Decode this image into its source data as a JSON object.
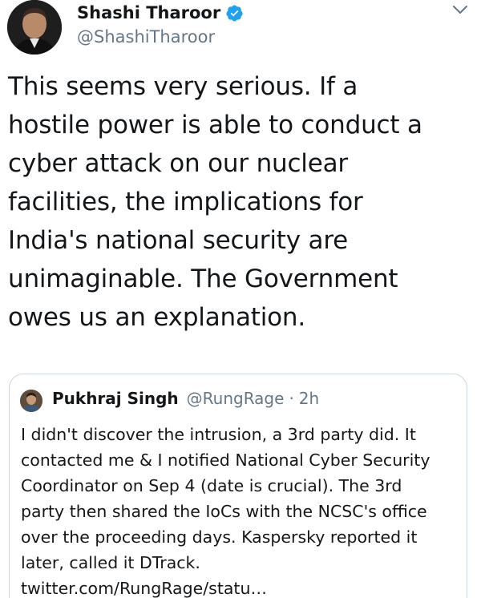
{
  "tweet": {
    "author_name": "Shashi Tharoor",
    "author_handle": "@ShashiTharoor",
    "text": "This seems very serious. If a\nhostile power is able to conduct a\ncyber attack on our nuclear\nfacilities, the implications for\nIndia's national security are\nunimaginable. The Government\nowes us an explanation."
  },
  "quoted_tweet": {
    "author_name": "Pukhraj Singh",
    "author_handle": "@RungRage",
    "separator": "·",
    "time": "2h",
    "text": "I didn't discover the intrusion, a 3rd party did. It\ncontacted me & I notified National Cyber Security\nCoordinator on Sep 4 (date is crucial). The 3rd\nparty then shared the IoCs with the NCSC's office\nover the proceeding days. Kaspersky reported it\nlater, called it DTrack.",
    "link": "twitter.com/RungRage/statu…"
  },
  "icons": {
    "verified": "verified-badge-icon",
    "menu": "chevron-down-icon"
  },
  "colors": {
    "verified_blue": "#1da1f2",
    "secondary_text": "#657786",
    "border": "#ccd6dd"
  }
}
